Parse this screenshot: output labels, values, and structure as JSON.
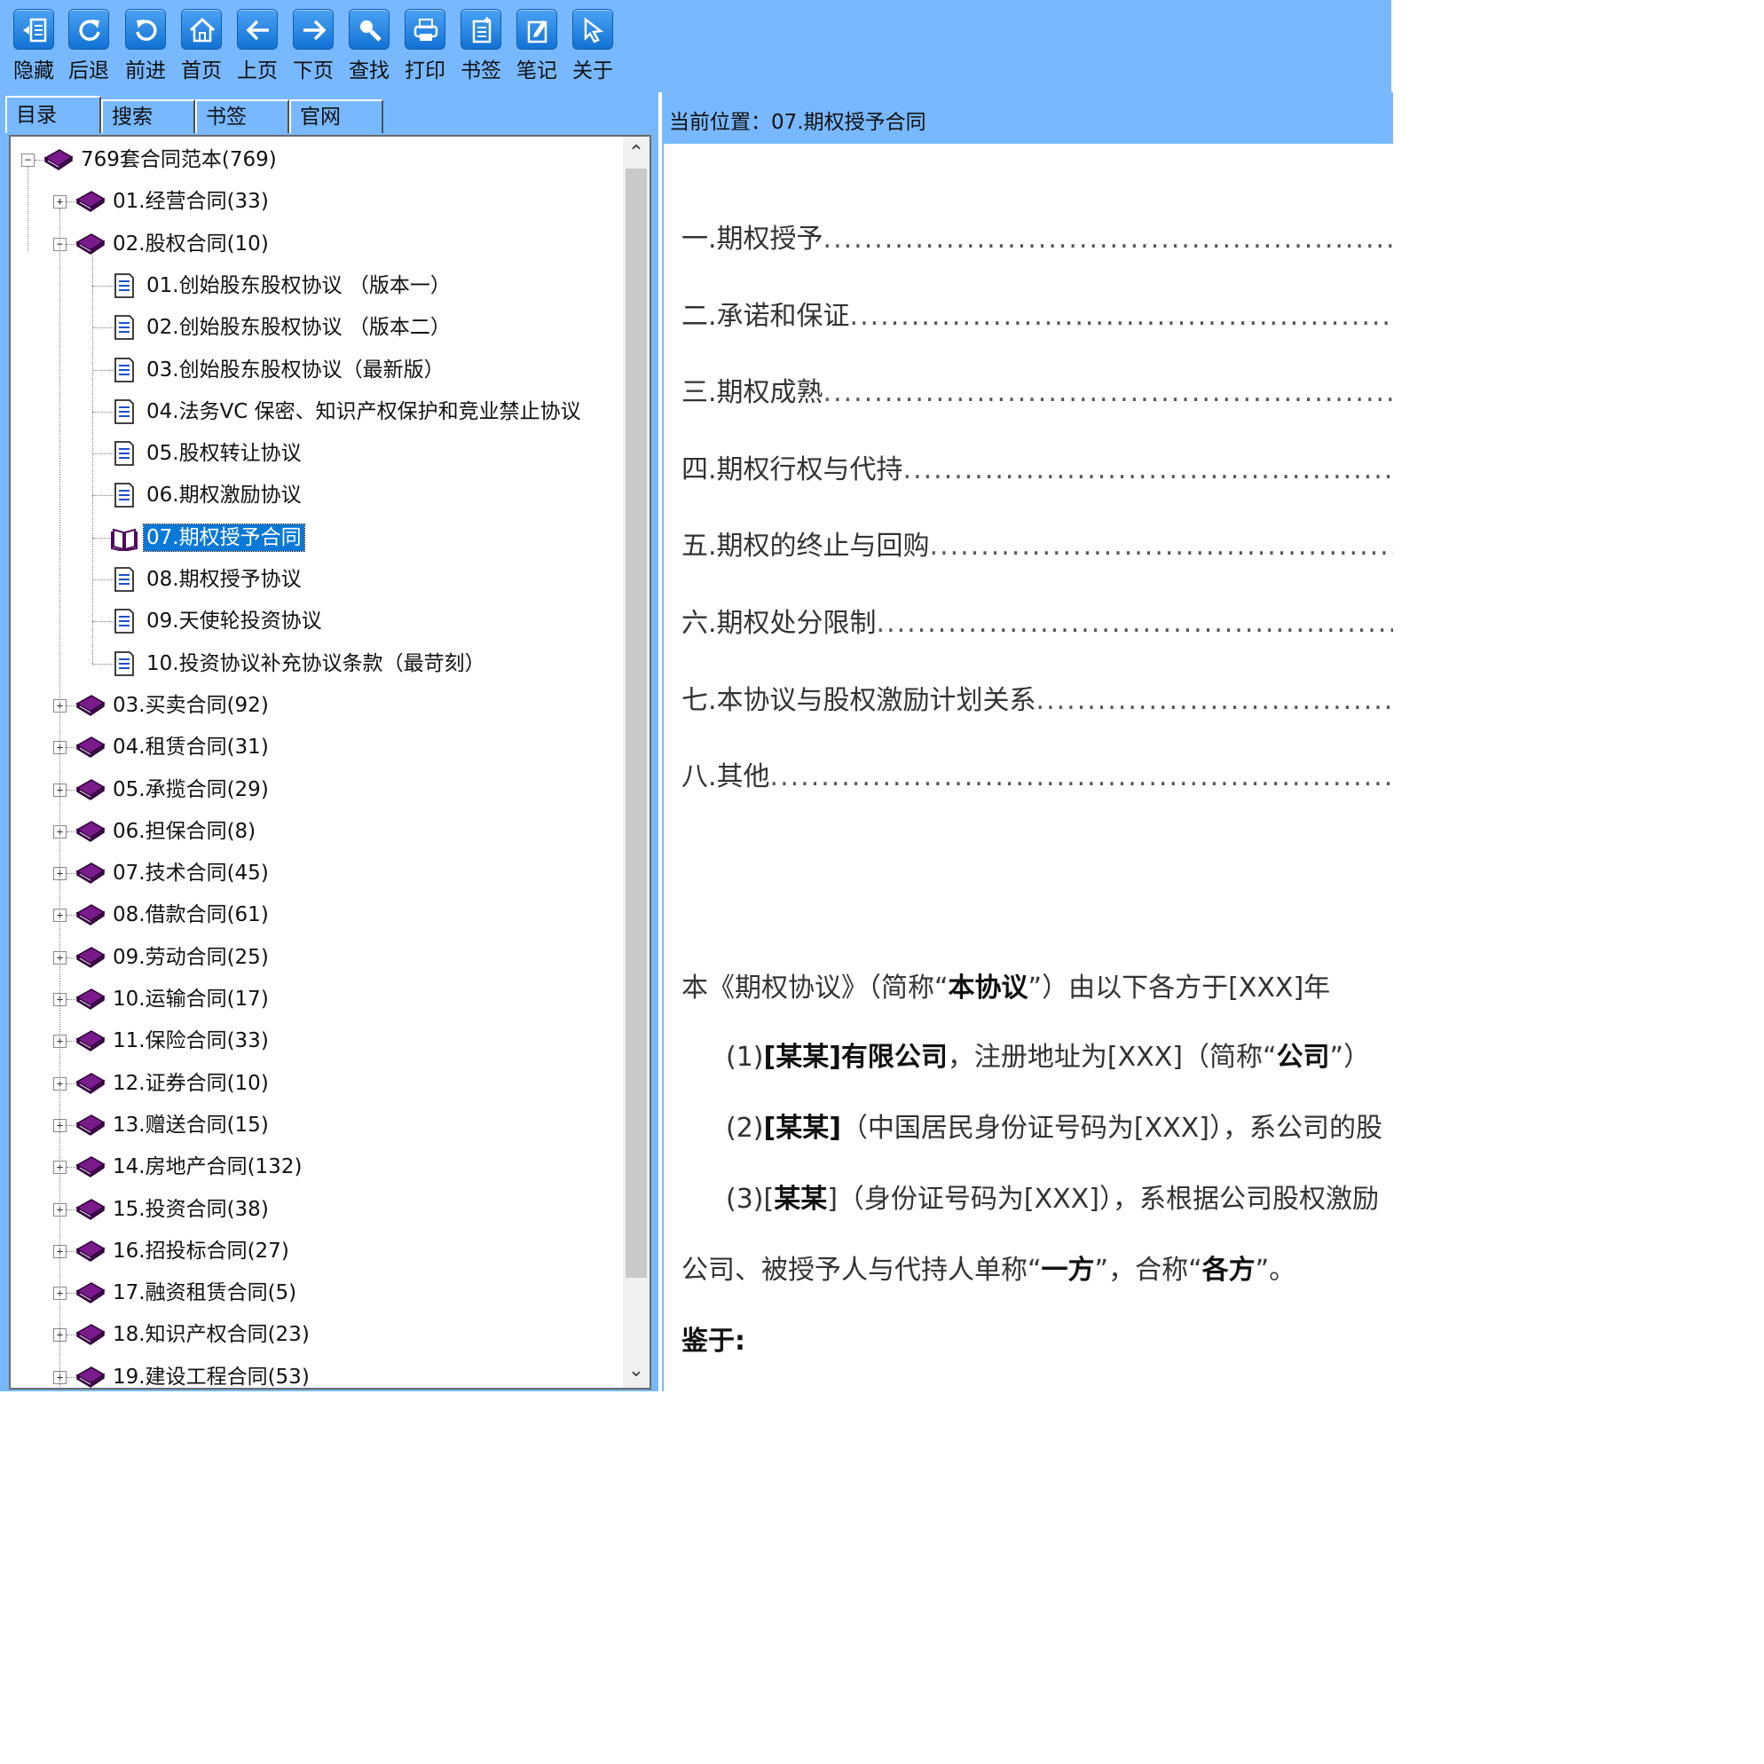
{
  "toolbar": {
    "buttons": [
      {
        "label": "隐藏",
        "icon": "hide-icon"
      },
      {
        "label": "后退",
        "icon": "refresh-back-icon"
      },
      {
        "label": "前进",
        "icon": "forward-rotate-icon"
      },
      {
        "label": "首页",
        "icon": "home-icon"
      },
      {
        "label": "上页",
        "icon": "arrow-left-icon"
      },
      {
        "label": "下页",
        "icon": "arrow-right-icon"
      },
      {
        "label": "查找",
        "icon": "search-icon"
      },
      {
        "label": "打印",
        "icon": "print-icon"
      },
      {
        "label": "书签",
        "icon": "bookmark-icon"
      },
      {
        "label": "笔记",
        "icon": "note-icon"
      },
      {
        "label": "关于",
        "icon": "about-cursor-icon"
      }
    ]
  },
  "tabs": [
    "目录",
    "搜索",
    "书签",
    "官网"
  ],
  "tree": {
    "root": "769套合同范本(769)",
    "categories_before": [
      "01.经营合同(33)"
    ],
    "expanded": "02.股权合同(10)",
    "children": [
      "01.创始股东股权协议 （版本一）",
      "02.创始股东股权协议 （版本二）",
      "03.创始股东股权协议（最新版）",
      "04.法务VC 保密、知识产权保护和竞业禁止协议",
      "05.股权转让协议",
      "06.期权激励协议",
      "07.期权授予合同",
      "08.期权授予协议",
      "09.天使轮投资协议",
      "10.投资协议补充协议条款（最苛刻）"
    ],
    "selected_child": "07.期权授予合同",
    "categories_after": [
      "03.买卖合同(92)",
      "04.租赁合同(31)",
      "05.承揽合同(29)",
      "06.担保合同(8)",
      "07.技术合同(45)",
      "08.借款合同(61)",
      "09.劳动合同(25)",
      "10.运输合同(17)",
      "11.保险合同(33)",
      "12.证券合同(10)",
      "13.赠送合同(15)",
      "14.房地产合同(132)",
      "15.投资合同(38)",
      "16.招投标合同(27)",
      "17.融资租赁合同(5)",
      "18.知识产权合同(23)",
      "19.建设工程合同(53)"
    ]
  },
  "location": "当前位置：07.期权授予合同",
  "document": {
    "toc": [
      "一.期权授予",
      "二.承诺和保证",
      "三.期权成熟",
      "四.期权行权与代持",
      "五.期权的终止与回购",
      "六.期权处分限制",
      "七.本协议与股权激励计划关系",
      "八.其他"
    ],
    "paragraphs": {
      "p1_a": "本《期权协议》（简称“",
      "p1_b": "本协议",
      "p1_c": "”）由以下各方于[XXX]年",
      "p2_a": "(1)",
      "p2_b": "[某某]有限公司",
      "p2_c": "，注册地址为[XXX]（简称“",
      "p2_d": "公司",
      "p2_e": "”）",
      "p3_a": "(2)",
      "p3_b": "[某某]",
      "p3_c": "（中国居民身份证号码为[XXX]），系公司的股",
      "p4_a": "(3)[",
      "p4_b": "某某",
      "p4_c": "]（身份证号码为[XXX]），系根据公司股权激励",
      "p5_a": "公司、被授予人与代持人单称“",
      "p5_b": "一方",
      "p5_c": "”，合称“",
      "p5_d": "各方",
      "p5_e": "”。",
      "p6": "鉴于:"
    }
  }
}
